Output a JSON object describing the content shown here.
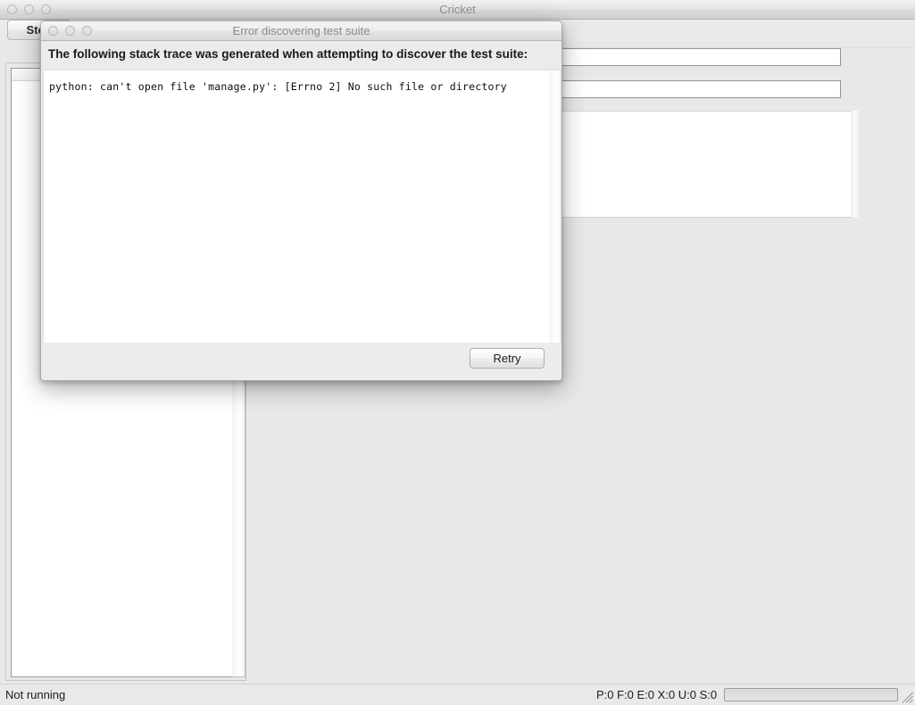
{
  "main_window": {
    "title": "Cricket",
    "traffic_lights": [
      "close-button",
      "minimize-button",
      "zoom-button"
    ],
    "toolbar": {
      "stop_label": "Stop"
    },
    "fields": {
      "field_one_value": "",
      "field_one_placeholder": "",
      "field_two_value": "",
      "field_two_placeholder": ""
    },
    "output": {
      "text": ""
    },
    "statusbar": {
      "status_text": "Not running",
      "counts_text": "P:0 F:0 E:0 X:0 U:0 S:0",
      "progress_percent": 0
    }
  },
  "dialog": {
    "title": "Error discovering test suite",
    "traffic_lights": [
      "close-button",
      "minimize-button",
      "zoom-button"
    ],
    "message": "The following stack trace was generated when attempting to discover the test suite:",
    "stack_trace": "python: can't open file 'manage.py': [Errno 2] No such file or directory",
    "retry_label": "Retry"
  },
  "colors": {
    "window_chrome": "#e8e8e8",
    "title_text": "#8e8e8e",
    "body_text": "#1a1a1a",
    "field_border": "#949494",
    "accent": "#4a90d9"
  }
}
